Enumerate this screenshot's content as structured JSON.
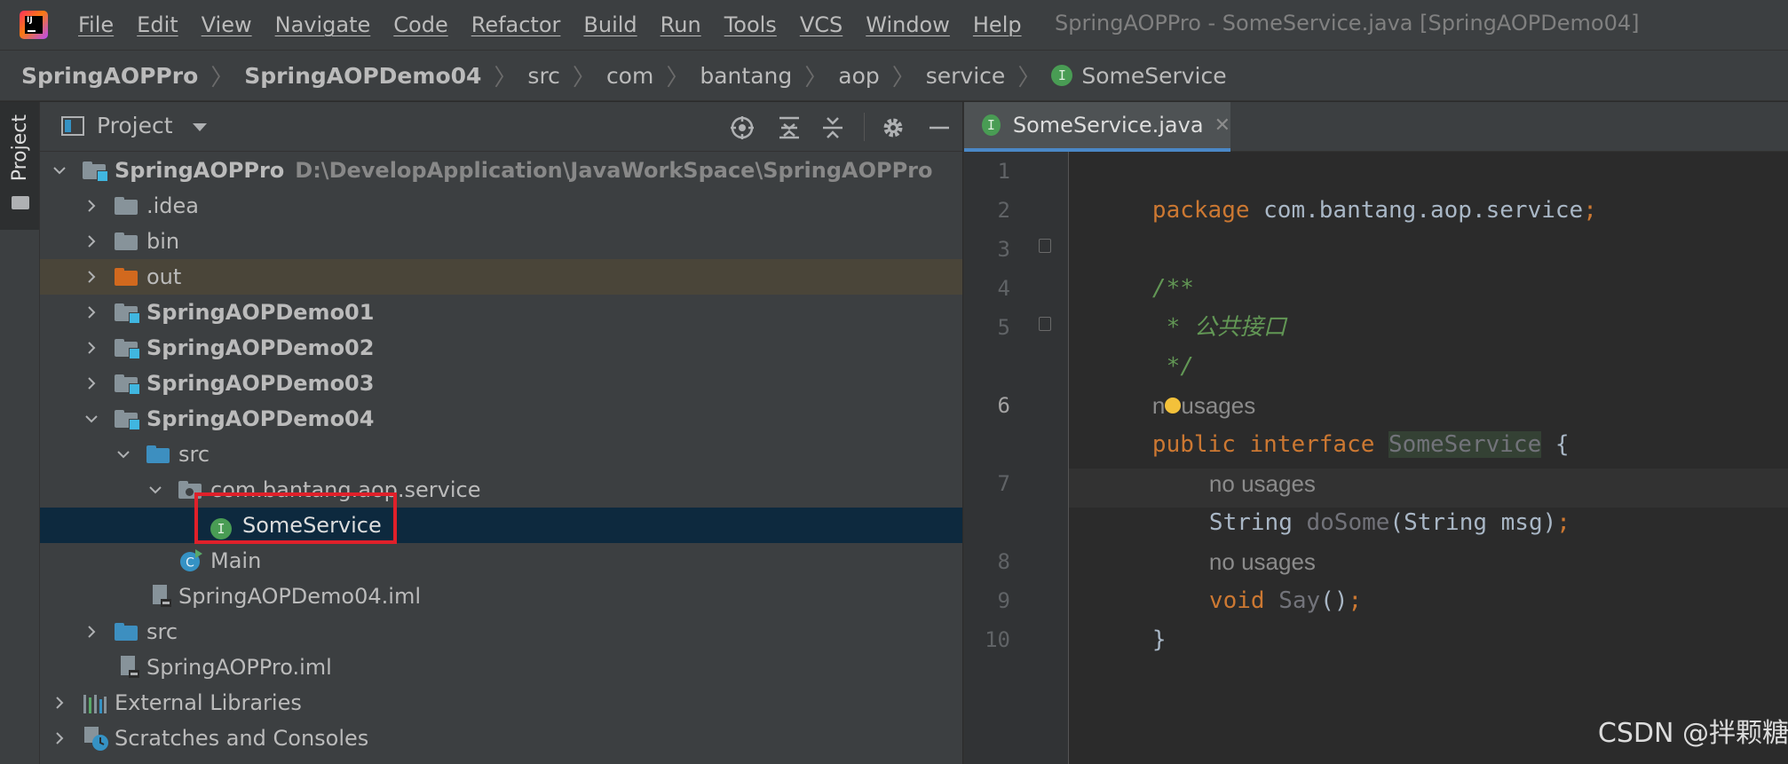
{
  "menubar": {
    "items": [
      "File",
      "Edit",
      "View",
      "Navigate",
      "Code",
      "Refactor",
      "Build",
      "Run",
      "Tools",
      "VCS",
      "Window",
      "Help"
    ],
    "title": "SpringAOPPro - SomeService.java [SpringAOPDemo04]"
  },
  "breadcrumb": {
    "items": [
      "SpringAOPPro",
      "SpringAOPDemo04",
      "src",
      "com",
      "bantang",
      "aop",
      "service",
      "SomeService"
    ]
  },
  "stripe": {
    "project_label": "Project"
  },
  "project_panel": {
    "title": "Project",
    "tree": [
      {
        "label": "SpringAOPPro",
        "path": "D:\\DevelopApplication\\JavaWorkSpace\\SpringAOPPro"
      },
      {
        "label": ".idea"
      },
      {
        "label": "bin"
      },
      {
        "label": "out"
      },
      {
        "label": "SpringAOPDemo01"
      },
      {
        "label": "SpringAOPDemo02"
      },
      {
        "label": "SpringAOPDemo03"
      },
      {
        "label": "SpringAOPDemo04"
      },
      {
        "label": "src"
      },
      {
        "label": "com.bantang.aop.service"
      },
      {
        "label": "SomeService"
      },
      {
        "label": "Main"
      },
      {
        "label": "SpringAOPDemo04.iml"
      },
      {
        "label": "src"
      },
      {
        "label": "SpringAOPPro.iml"
      },
      {
        "label": "External Libraries"
      },
      {
        "label": "Scratches and Consoles"
      }
    ]
  },
  "editor": {
    "tab_label": "SomeService.java",
    "badge": "I",
    "line_numbers": [
      "1",
      "2",
      "3",
      "4",
      "5",
      "6",
      "7",
      "8",
      "9",
      "10"
    ],
    "code": {
      "l1_kw": "package",
      "l1_pkg": " com.bantang.aop.service",
      "l1_semi": ";",
      "l3": "/**",
      "l4": " * 公共接口",
      "l5": " */",
      "hint_a": "n",
      "hint_b": "usages",
      "l6_kw1": "public",
      "l6_kw2": " interface ",
      "l6_name": "SomeService",
      "l6_brace": " {",
      "hint7": "no usages",
      "l7_type": "String ",
      "l7_method": "doSome",
      "l7_params": "(String msg)",
      "l7_semi": ";",
      "hint8": "no usages",
      "l8_kw": "void ",
      "l8_method": "Say",
      "l8_parens": "()",
      "l8_semi": ";",
      "l9": "}"
    }
  },
  "watermark": "CSDN @拌颗糖",
  "colors": {
    "selection": "#0d293e",
    "out_highlight": "#4a4539",
    "keyword": "#cc7832",
    "comment": "#629755",
    "interface_badge": "#499c54",
    "annotation_box": "#e0202a"
  }
}
